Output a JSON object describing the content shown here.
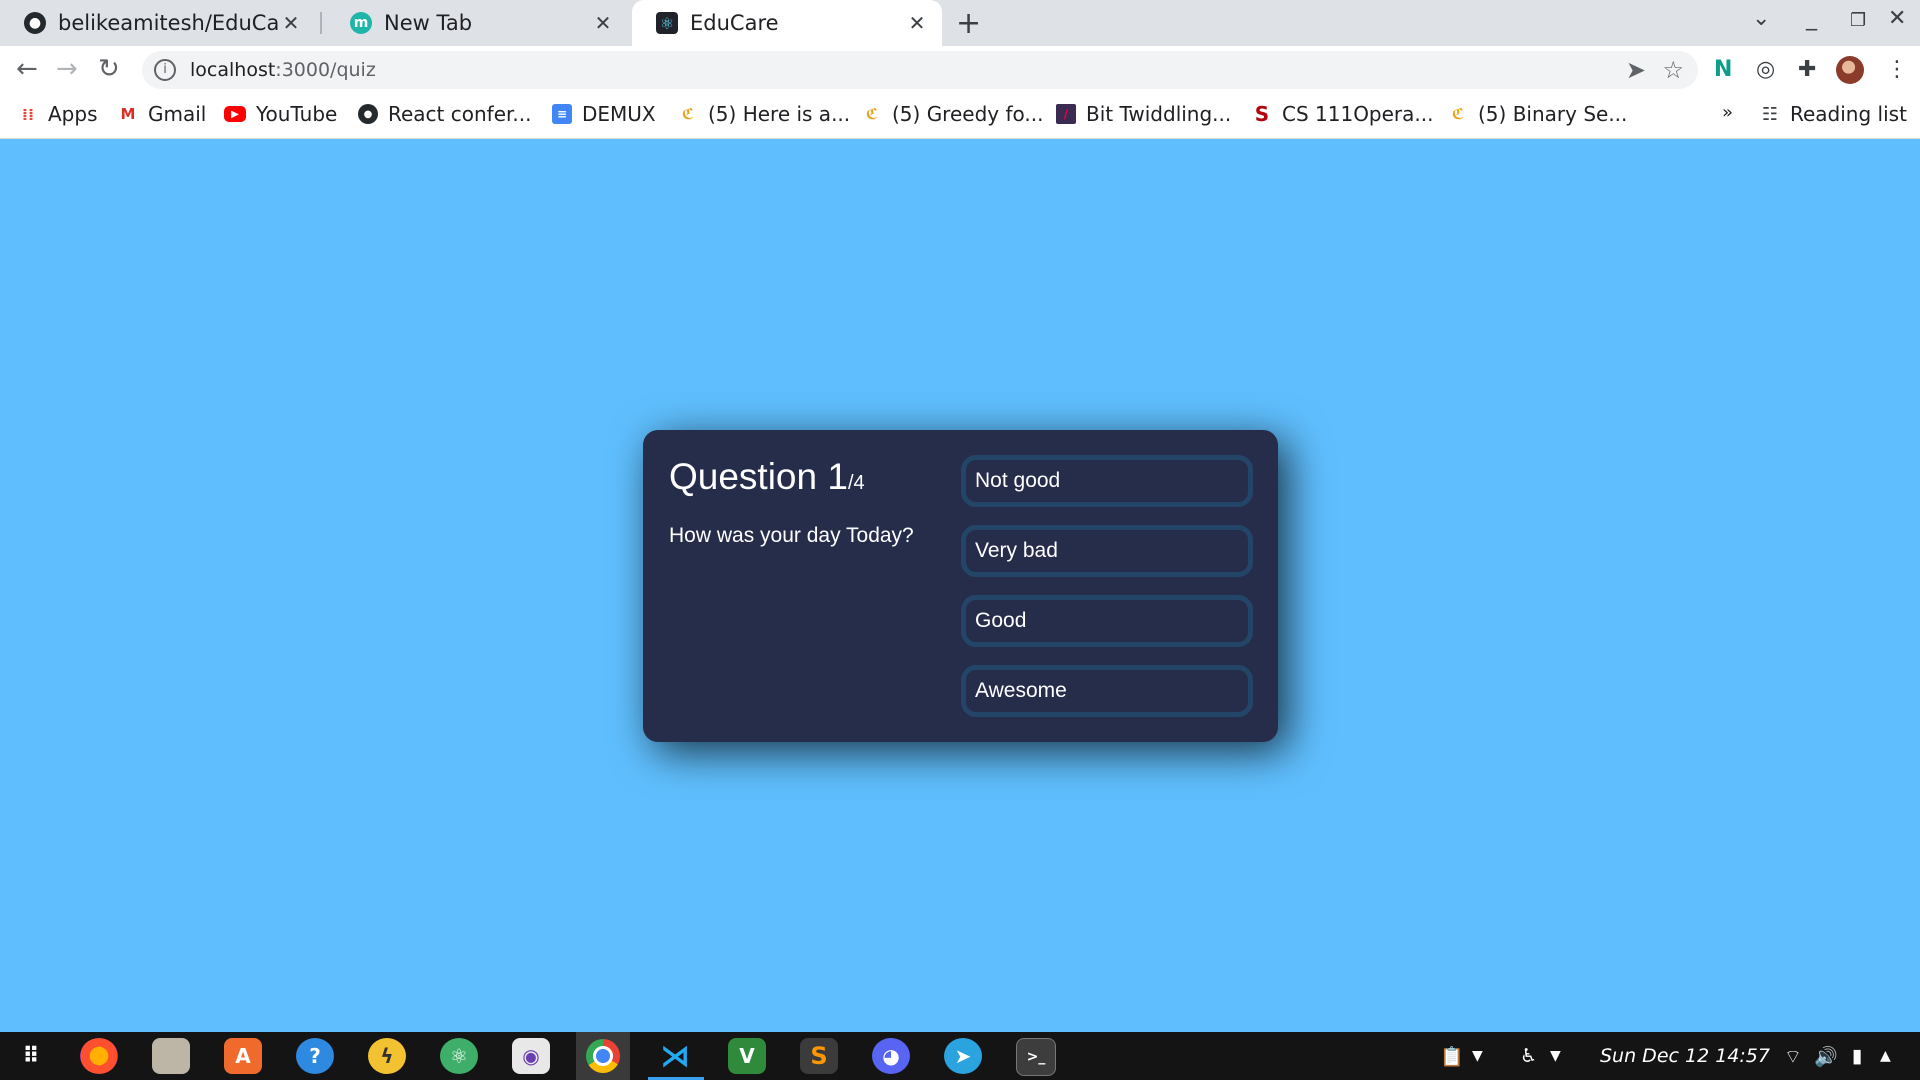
{
  "browser": {
    "tabs": [
      {
        "title": "belikeamitesh/EduCare",
        "icon": "github-icon"
      },
      {
        "title": "New Tab",
        "icon": "new-tab-m-icon"
      },
      {
        "title": "EduCare",
        "icon": "react-icon"
      }
    ],
    "url_host": "localhost",
    "url_path": ":3000/quiz",
    "bookmarks": [
      {
        "label": "Apps",
        "icon": "apps-grid-icon"
      },
      {
        "label": "Gmail",
        "icon": "gmail-icon"
      },
      {
        "label": "YouTube",
        "icon": "youtube-icon"
      },
      {
        "label": "React confer...",
        "icon": "github-icon"
      },
      {
        "label": "DEMUX",
        "icon": "docs-icon"
      },
      {
        "label": "(5) Here is a...",
        "icon": "leetcode-icon"
      },
      {
        "label": "(5) Greedy fo...",
        "icon": "leetcode-icon"
      },
      {
        "label": "Bit Twiddling...",
        "icon": "bookmark-page-icon"
      },
      {
        "label": "CS 111Opera...",
        "icon": "stanford-icon"
      },
      {
        "label": "(5) Binary Se...",
        "icon": "leetcode-icon"
      }
    ],
    "overflow": "»",
    "reading_list": "Reading list"
  },
  "quiz": {
    "question_label": "Question 1",
    "question_total": "/4",
    "question_text": "How was your day Today?",
    "answers": [
      "Not good",
      "Very bad",
      "Good",
      "Awesome"
    ]
  },
  "taskbar": {
    "apps": [
      "app-grid-icon",
      "firefox-icon",
      "files-icon",
      "software-center-icon",
      "help-icon",
      "pokemon-icon",
      "atom-icon",
      "camera-icon",
      "chrome-icon",
      "vscode-icon",
      "vim-icon",
      "sublime-icon",
      "discord-icon",
      "telegram-icon",
      "terminal-icon"
    ],
    "clock": "Sun Dec 12  14:57"
  },
  "colors": {
    "page_background": "#5fbffe",
    "card_background": "#252d4a",
    "answer_border": "#234668"
  }
}
